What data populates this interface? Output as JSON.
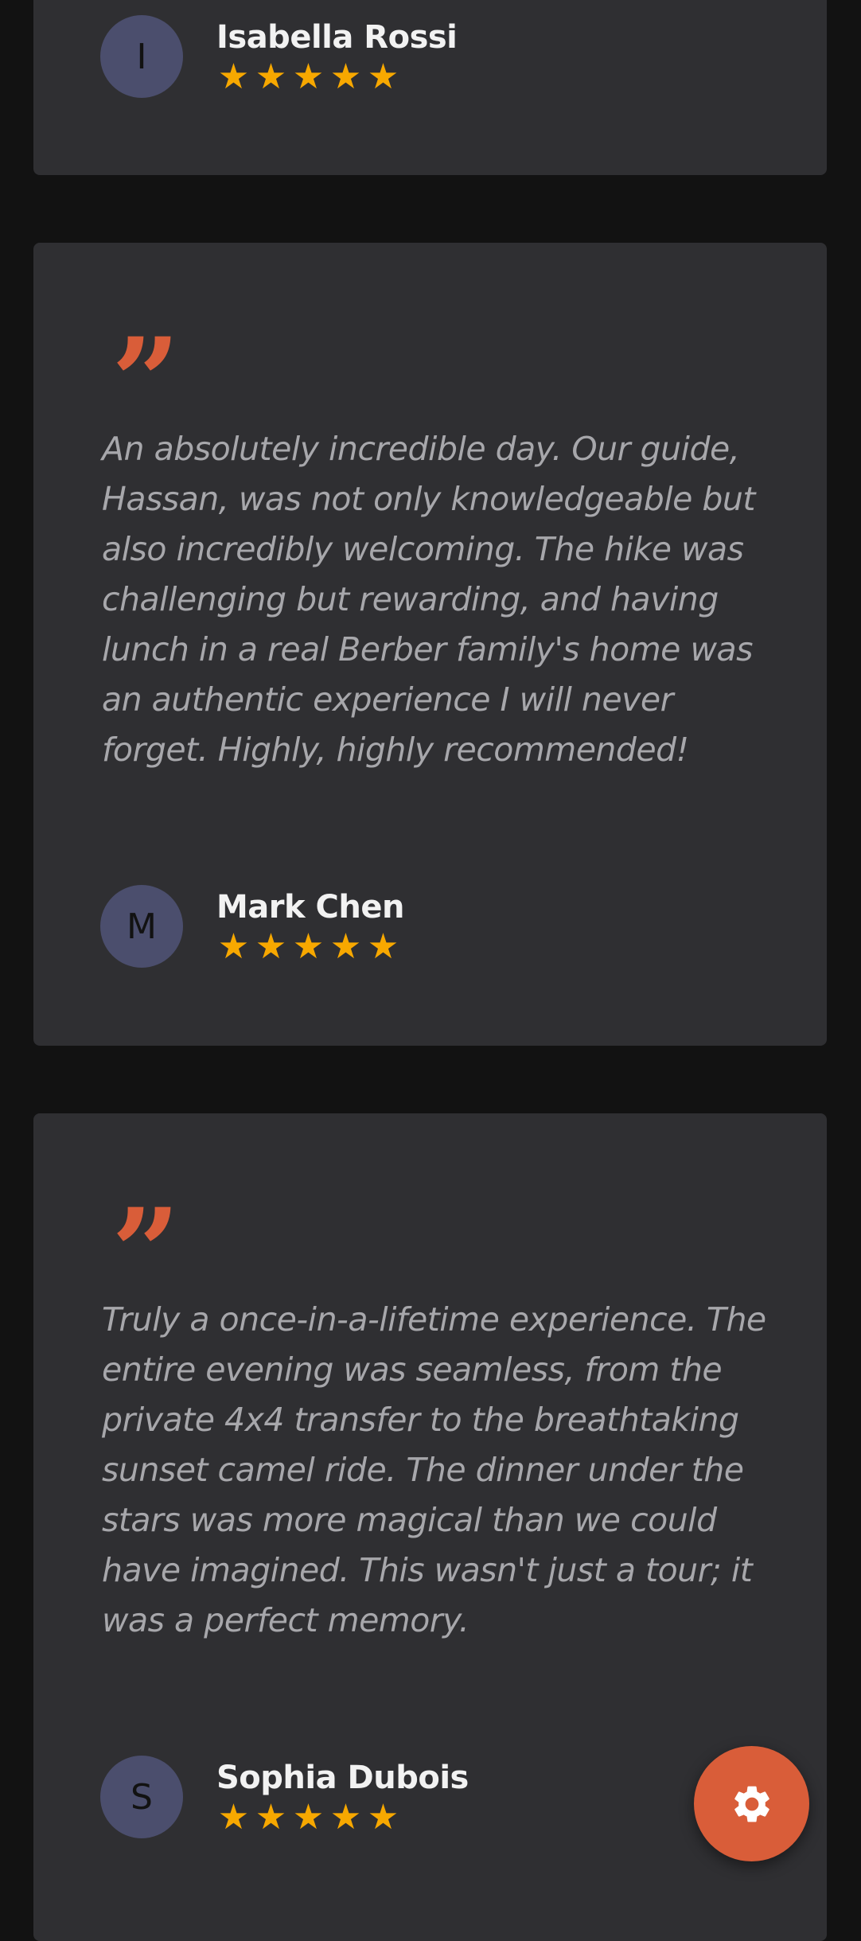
{
  "colors": {
    "background": "#121212",
    "card": "#2f2f32",
    "accent": "#d95d39",
    "star": "#f7a800",
    "review_text": "#a7a7ab",
    "name": "#f2f2f2",
    "avatar": "#4b4e6d"
  },
  "reviews": [
    {
      "quote_icon": "quote-icon",
      "text": "",
      "author": {
        "initial": "I",
        "name": "Isabella Rossi"
      },
      "rating": 5
    },
    {
      "quote_icon": "quote-icon",
      "text": "An absolutely incredible day. Our guide, Hassan, was not only knowledgeable but also incredibly welcoming. The hike was challenging but rewarding, and having lunch in a real Berber family's home was an authentic experience I will never forget. Highly, highly recommended!",
      "author": {
        "initial": "M",
        "name": "Mark Chen"
      },
      "rating": 5
    },
    {
      "quote_icon": "quote-icon",
      "text": "Truly a once-in-a-lifetime experience. The entire evening was seamless, from the private 4x4 transfer to the breathtaking sunset camel ride. The dinner under the stars was more magical than we could have imagined. This wasn't just a tour; it was a perfect memory.",
      "author": {
        "initial": "S",
        "name": "Sophia Dubois"
      },
      "rating": 5
    }
  ],
  "fab": {
    "icon": "gear-icon"
  }
}
